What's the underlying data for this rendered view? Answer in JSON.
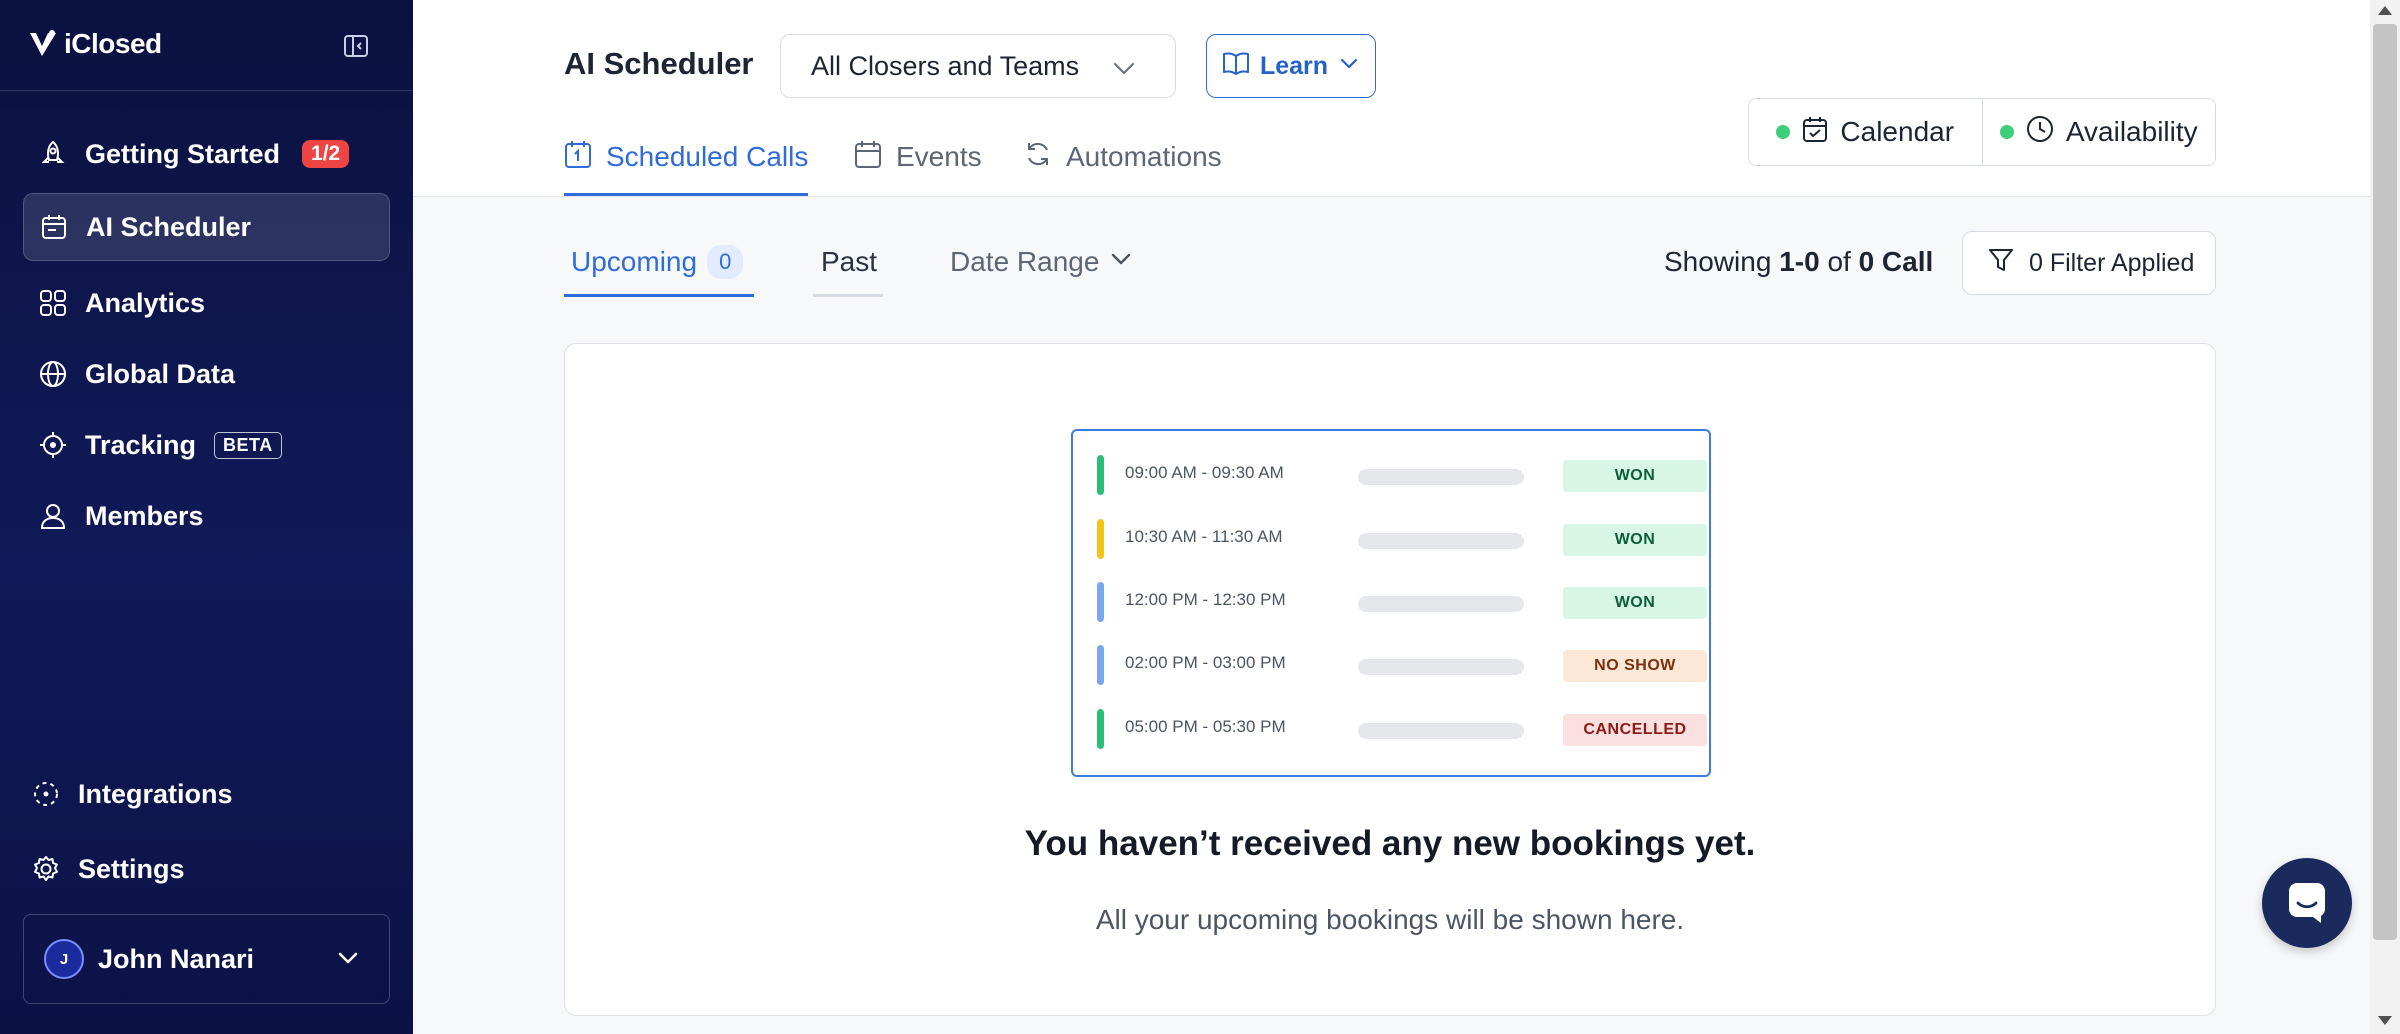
{
  "brand": {
    "name": "iClosed"
  },
  "sidebar": {
    "items": [
      {
        "label": "Getting Started",
        "badge": "1/2",
        "icon": "rocket-icon"
      },
      {
        "label": "AI Scheduler",
        "icon": "calendar-icon",
        "active": true
      },
      {
        "label": "Analytics",
        "icon": "grid-icon"
      },
      {
        "label": "Global Data",
        "icon": "globe-icon"
      },
      {
        "label": "Tracking",
        "badge": "BETA",
        "icon": "target-icon"
      },
      {
        "label": "Members",
        "icon": "users-icon"
      }
    ],
    "bottom_items": [
      {
        "label": "Integrations",
        "icon": "integrations-icon"
      },
      {
        "label": "Settings",
        "icon": "gear-icon"
      }
    ],
    "user": {
      "initial": "J",
      "name": "John Nanari"
    }
  },
  "header": {
    "title": "AI Scheduler",
    "team_select": "All Closers and Teams",
    "learn_label": "Learn",
    "tabs": [
      {
        "label": "Scheduled Calls",
        "active": true
      },
      {
        "label": "Events"
      },
      {
        "label": "Automations"
      }
    ],
    "segments": [
      {
        "label": "Calendar",
        "status_color": "#3fcf7a"
      },
      {
        "label": "Availability",
        "status_color": "#3fcf7a"
      }
    ]
  },
  "subbar": {
    "tabs": [
      {
        "label": "Upcoming",
        "count": "0",
        "active": true
      },
      {
        "label": "Past"
      },
      {
        "label": "Date Range"
      }
    ],
    "showing": {
      "prefix": "Showing",
      "range": "1-0",
      "of": "of",
      "total": "0 Call"
    },
    "filter_label": "0 Filter Applied"
  },
  "illustration": {
    "rows": [
      {
        "time": "09:00 AM - 09:30 AM",
        "status": "WON",
        "bar_color": "#2dbd7a"
      },
      {
        "time": "10:30 AM - 11:30 AM",
        "status": "WON",
        "bar_color": "#f2c418"
      },
      {
        "time": "12:00 PM - 12:30 PM",
        "status": "WON",
        "bar_color": "#7aa7ee"
      },
      {
        "time": "02:00 PM - 03:00 PM",
        "status": "NO SHOW",
        "bar_color": "#7aa7ee"
      },
      {
        "time": "05:00 PM - 05:30 PM",
        "status": "CANCELLED",
        "bar_color": "#2dbd7a"
      }
    ]
  },
  "empty_state": {
    "title": "You haven’t received any new bookings yet.",
    "subtitle": "All your upcoming bookings will be shown here."
  },
  "colors": {
    "accent": "#2f6bd9",
    "sidebar_bg": "#0b1140",
    "won": "#d8f6e6",
    "no_show": "#fde8d7",
    "cancelled": "#fbe0e0"
  }
}
